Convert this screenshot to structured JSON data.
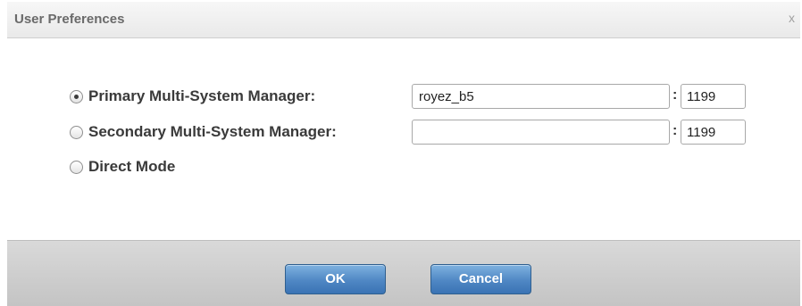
{
  "dialog": {
    "title": "User Preferences",
    "close_label": "x"
  },
  "options": [
    {
      "label": "Primary Multi-System Manager:",
      "checked": true,
      "host": "royez_b5",
      "port": "1199"
    },
    {
      "label": "Secondary Multi-System Manager:",
      "checked": false,
      "host": "",
      "port": "1199"
    },
    {
      "label": "Direct Mode",
      "checked": false
    }
  ],
  "separator": ":",
  "buttons": {
    "ok_label": "OK",
    "cancel_label": "Cancel"
  }
}
